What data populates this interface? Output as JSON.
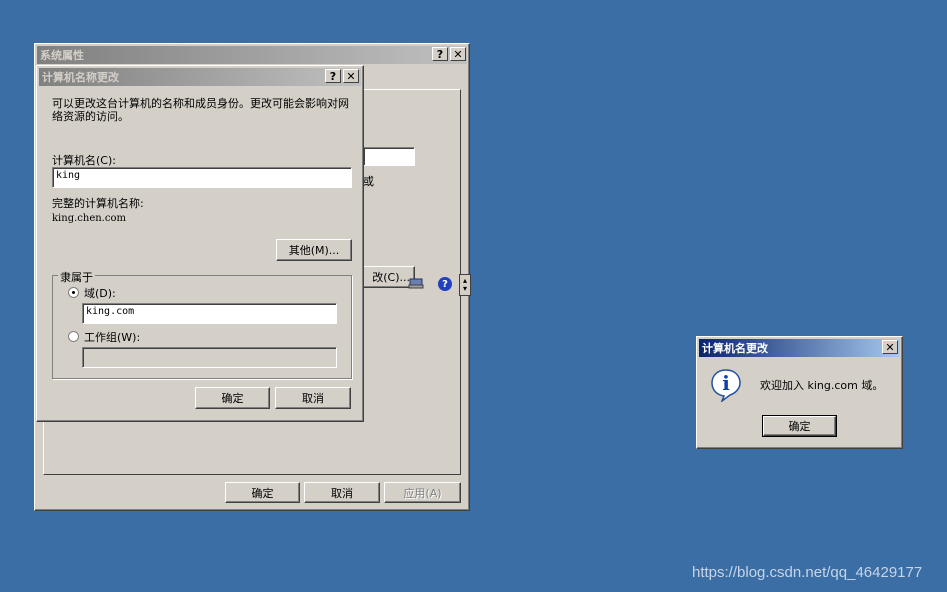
{
  "system_props": {
    "title": "系统属性",
    "help_btn": "?",
    "close_btn": "✕",
    "partial_button": "改(C)...",
    "partial_text": "或",
    "ok": "确定",
    "cancel": "取消",
    "apply": "应用(A)"
  },
  "rename_dialog": {
    "title": "计算机名称更改",
    "help_btn": "?",
    "close_btn": "✕",
    "description": "可以更改这台计算机的名称和成员身份。更改可能会影响对网络资源的访问。",
    "computer_name_label": "计算机名(C):",
    "computer_name_value": "king",
    "full_name_label": "完整的计算机名称:",
    "full_name_value": "king.chen.com",
    "more_button": "其他(M)...",
    "member_of_label": "隶属于",
    "domain_label": "域(D):",
    "domain_value": "king.com",
    "workgroup_label": "工作组(W):",
    "workgroup_value": "",
    "ok": "确定",
    "cancel": "取消"
  },
  "welcome_dialog": {
    "title": "计算机名更改",
    "close_btn": "✕",
    "message": "欢迎加入 king.com 域。",
    "ok": "确定",
    "info_icon_glyph": "i"
  },
  "watermark": "https://blog.csdn.net/qq_46429177",
  "colors": {
    "desktop": "#3a6ea5",
    "active_title_start": "#0a246a",
    "active_title_end": "#a6caf0",
    "inactive_title_start": "#808080",
    "inactive_title_end": "#c0c0c0",
    "window_face": "#d4d0c8"
  }
}
